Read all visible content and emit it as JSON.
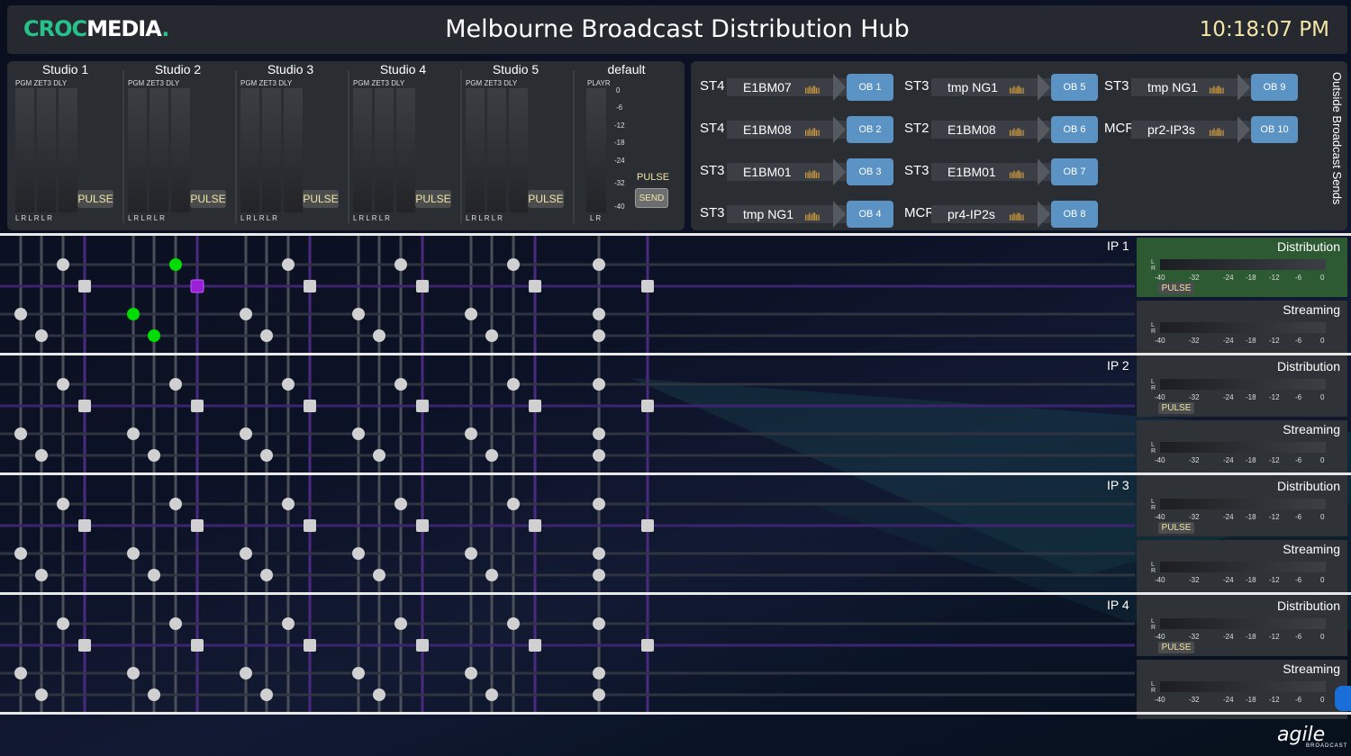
{
  "header": {
    "logo_part1": "CROC",
    "logo_part2": "MEDIA",
    "logo_dot": ".",
    "title": "Melbourne Broadcast Distribution Hub",
    "clock": "10:18:07 PM"
  },
  "studios": [
    {
      "name": "Studio 1",
      "channels": "PGM ZET3 DLY",
      "lr": "L R  L R  L R",
      "pulse": "PULSE"
    },
    {
      "name": "Studio 2",
      "channels": "PGM ZET3 DLY",
      "lr": "L R  L R  L R",
      "pulse": "PULSE"
    },
    {
      "name": "Studio 3",
      "channels": "PGM ZET3 DLY",
      "lr": "L R  L R  L R",
      "pulse": "PULSE"
    },
    {
      "name": "Studio 4",
      "channels": "PGM ZET3 DLY",
      "lr": "L R  L R  L R",
      "pulse": "PULSE"
    },
    {
      "name": "Studio 5",
      "channels": "PGM ZET3 DLY",
      "lr": "L R  L R  L R",
      "pulse": "PULSE"
    }
  ],
  "default_panel": {
    "name": "default",
    "channel": "PLAYR",
    "lr": "L R",
    "scale": [
      "0",
      "-6",
      "-12",
      "-18",
      "-24",
      "-32",
      "-40"
    ],
    "pulse_label": "PULSE",
    "send": "SEND"
  },
  "ob_sends": {
    "title": "Outside Broadcast Sends",
    "wave_icon": "audio-wave-icon",
    "routes": [
      {
        "src": "ST4",
        "feed": "E1BM07",
        "dest": "OB 1"
      },
      {
        "src": "ST4",
        "feed": "E1BM08",
        "dest": "OB 2"
      },
      {
        "src": "ST3",
        "feed": "E1BM01",
        "dest": "OB 3"
      },
      {
        "src": "ST3",
        "feed": "tmp NG1",
        "dest": "OB 4"
      },
      {
        "src": "ST3",
        "feed": "tmp NG1",
        "dest": "OB 5"
      },
      {
        "src": "ST2",
        "feed": "E1BM08",
        "dest": "OB 6"
      },
      {
        "src": "ST3",
        "feed": "E1BM01",
        "dest": "OB 7"
      },
      {
        "src": "MCR",
        "feed": "pr4-IP2s",
        "dest": "OB 8"
      },
      {
        "src": "ST3",
        "feed": "tmp NG1",
        "dest": "OB 9"
      },
      {
        "src": "MCR",
        "feed": "pr2-IP3s",
        "dest": "OB 10"
      }
    ]
  },
  "outputs": [
    {
      "ip": "IP 1",
      "rows": [
        {
          "title": "Distribution",
          "scale": [
            "-40",
            "-32",
            "-24",
            "-18",
            "-12",
            "-6",
            "0"
          ],
          "pulse": "PULSE",
          "active": true
        },
        {
          "title": "Streaming",
          "scale": [
            "-40",
            "-32",
            "-24",
            "-18",
            "-12",
            "-6",
            "0"
          ]
        }
      ],
      "active_nodes": [
        [
          1,
          7
        ],
        [
          2,
          8
        ],
        [
          3,
          5
        ],
        [
          4,
          6
        ]
      ]
    },
    {
      "ip": "IP 2",
      "rows": [
        {
          "title": "Distribution",
          "scale": [
            "-40",
            "-32",
            "-24",
            "-18",
            "-12",
            "-6",
            "0"
          ],
          "pulse": "PULSE"
        },
        {
          "title": "Streaming",
          "scale": [
            "-40",
            "-32",
            "-24",
            "-18",
            "-12",
            "-6",
            "0"
          ]
        }
      ],
      "active_nodes": [
        [
          1,
          23
        ],
        [
          2,
          24
        ],
        [
          3,
          21
        ],
        [
          4,
          22
        ]
      ]
    },
    {
      "ip": "IP 3",
      "rows": [
        {
          "title": "Distribution",
          "scale": [
            "-40",
            "-32",
            "-24",
            "-18",
            "-12",
            "-6",
            "0"
          ],
          "pulse": "PULSE"
        },
        {
          "title": "Streaming",
          "scale": [
            "-40",
            "-32",
            "-24",
            "-18",
            "-12",
            "-6",
            "0"
          ]
        }
      ],
      "active_nodes": []
    },
    {
      "ip": "IP 4",
      "rows": [
        {
          "title": "Distribution",
          "scale": [
            "-40",
            "-32",
            "-24",
            "-18",
            "-12",
            "-6",
            "0"
          ],
          "pulse": "PULSE"
        },
        {
          "title": "Streaming",
          "scale": [
            "-40",
            "-32",
            "-24",
            "-18",
            "-12",
            "-6",
            "0"
          ]
        }
      ],
      "active_nodes": []
    }
  ],
  "brand": {
    "name": "agile",
    "sub": "BROADCAST"
  },
  "colors": {
    "accent_green": "#26c28a",
    "active_node": "#00dd00",
    "active_square": "#9a1fd6",
    "ob_button": "#5a93c4",
    "clock": "#f3e6a7"
  }
}
